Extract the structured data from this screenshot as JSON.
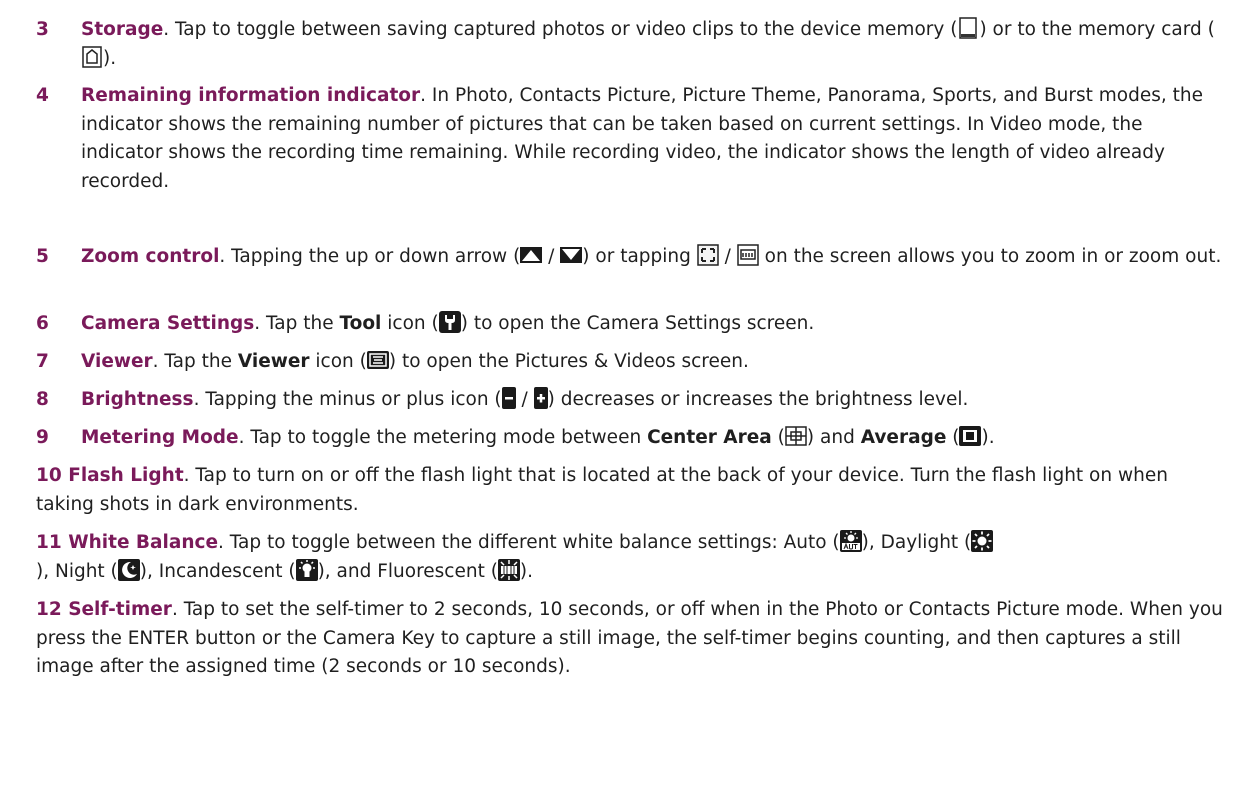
{
  "items": [
    {
      "num": "3",
      "title": "Storage",
      "p1": ". Tap to toggle between saving captured photos or video clips to the device memory (",
      "p2": ") or to the memory card (",
      "p3": ")."
    },
    {
      "num": "4",
      "title": "Remaining information indicator",
      "p1": ". In Photo, Contacts Picture, Picture Theme, Panorama, Sports, and Burst modes, the indicator shows the remaining number of pictures that can be taken based on current settings. In Video mode, the indicator shows the recording time remaining. While recording video, the indicator shows the length of video already recorded."
    },
    {
      "num": "5",
      "title": "Zoom control",
      "p1": ". Tapping the up or down arrow (",
      "s1": " / ",
      "p2": ") or tapping ",
      "s2": " / ",
      "p3": " on the screen allows you to zoom in or zoom out."
    },
    {
      "num": "6",
      "title": "Camera Settings",
      "p1": ". Tap the ",
      "b1": "Tool",
      "p2": " icon (",
      "p3": ") to open the Camera Settings screen."
    },
    {
      "num": "7",
      "title": "Viewer",
      "p1": ". Tap the ",
      "b1": "Viewer",
      "p2": " icon (",
      "p3": ") to open the Pictures & Videos screen."
    },
    {
      "num": "8",
      "title": "Brightness",
      "p1": ". Tapping the minus or plus icon (",
      "s1": " / ",
      "p2": ") decreases or increases the brightness level."
    },
    {
      "num": "9",
      "title": "Metering Mode",
      "p1": ". Tap to toggle the metering mode between ",
      "b1": "Center Area",
      "p2": " (",
      "p3": ") and ",
      "b2": "Average",
      "p4": " (",
      "p5": ")."
    },
    {
      "num": "10",
      "title": "Flash Light",
      "p1": ". Tap to turn on or off the flash light that is located at the back of your device. Turn the flash light on when taking shots in dark environments."
    },
    {
      "num": "11",
      "title": "White Balance",
      "p1": ". Tap to toggle between the different white balance settings: Auto (",
      "p2": "), Daylight (",
      "p3": "), Night (",
      "p4": "), Incandescent (",
      "p5": "), and Fluorescent (",
      "p6": ")."
    },
    {
      "num": "12",
      "title": "Self-timer",
      "p1": ". Tap to set the self-timer to 2 seconds, 10 seconds, or off when in the Photo or Contacts Picture mode. When you press the ENTER button or the Camera Key to capture a still image, the self-timer begins counting, and then captures a still image after the assigned time (2 seconds or 10 seconds)."
    }
  ],
  "colors": {
    "heading": "#7a1a5a",
    "text": "#1f1f1f"
  }
}
